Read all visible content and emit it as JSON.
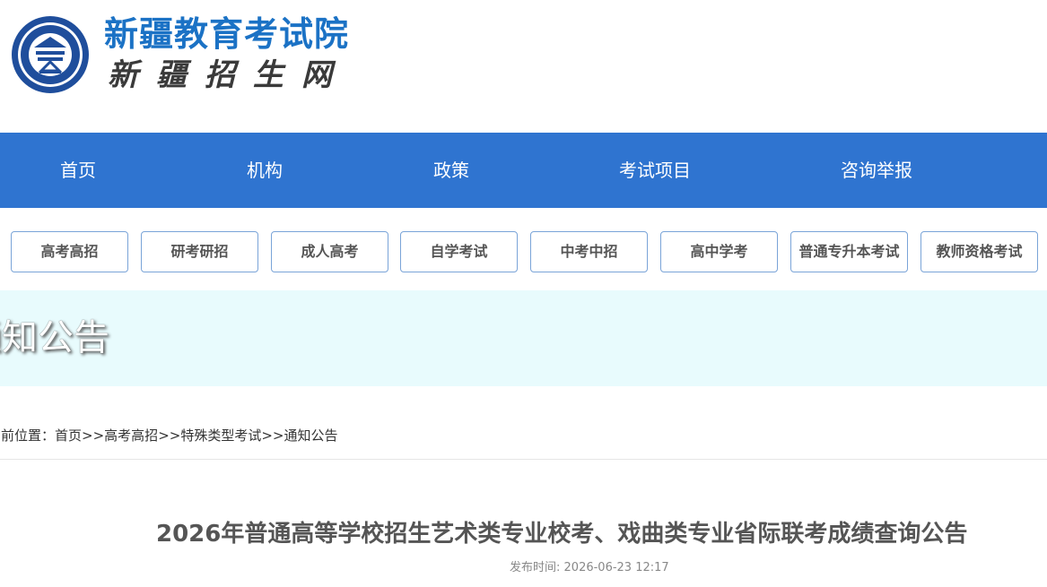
{
  "header": {
    "site_title": "新疆教育考试院",
    "site_subtitle": "新疆招生网",
    "logo_icon": "education-seal-logo",
    "brand_color": "#1b72c5"
  },
  "nav": {
    "background": "#2f74d0",
    "items": [
      {
        "label": "首页"
      },
      {
        "label": "机构"
      },
      {
        "label": "政策"
      },
      {
        "label": "考试项目"
      },
      {
        "label": "咨询举报"
      }
    ]
  },
  "subnav": {
    "tabs": [
      {
        "label": "高考高招"
      },
      {
        "label": "研考研招"
      },
      {
        "label": "成人高考"
      },
      {
        "label": "自学考试"
      },
      {
        "label": "中考中招"
      },
      {
        "label": "高中学考"
      },
      {
        "label": "普通专升本考试"
      },
      {
        "label": "教师资格考试"
      }
    ]
  },
  "banner": {
    "title": "通知公告"
  },
  "breadcrumb": {
    "prefix": "当前位置：",
    "items": [
      "首页",
      "高考高招",
      "特殊类型考试",
      "通知公告"
    ],
    "separator": ">>"
  },
  "article": {
    "title": "2026年普通高等学校招生艺术类专业校考、戏曲类专业省际联考成绩查询公告",
    "publish_label": "发布时间:",
    "publish_time": "2026-06-23 12:17"
  }
}
